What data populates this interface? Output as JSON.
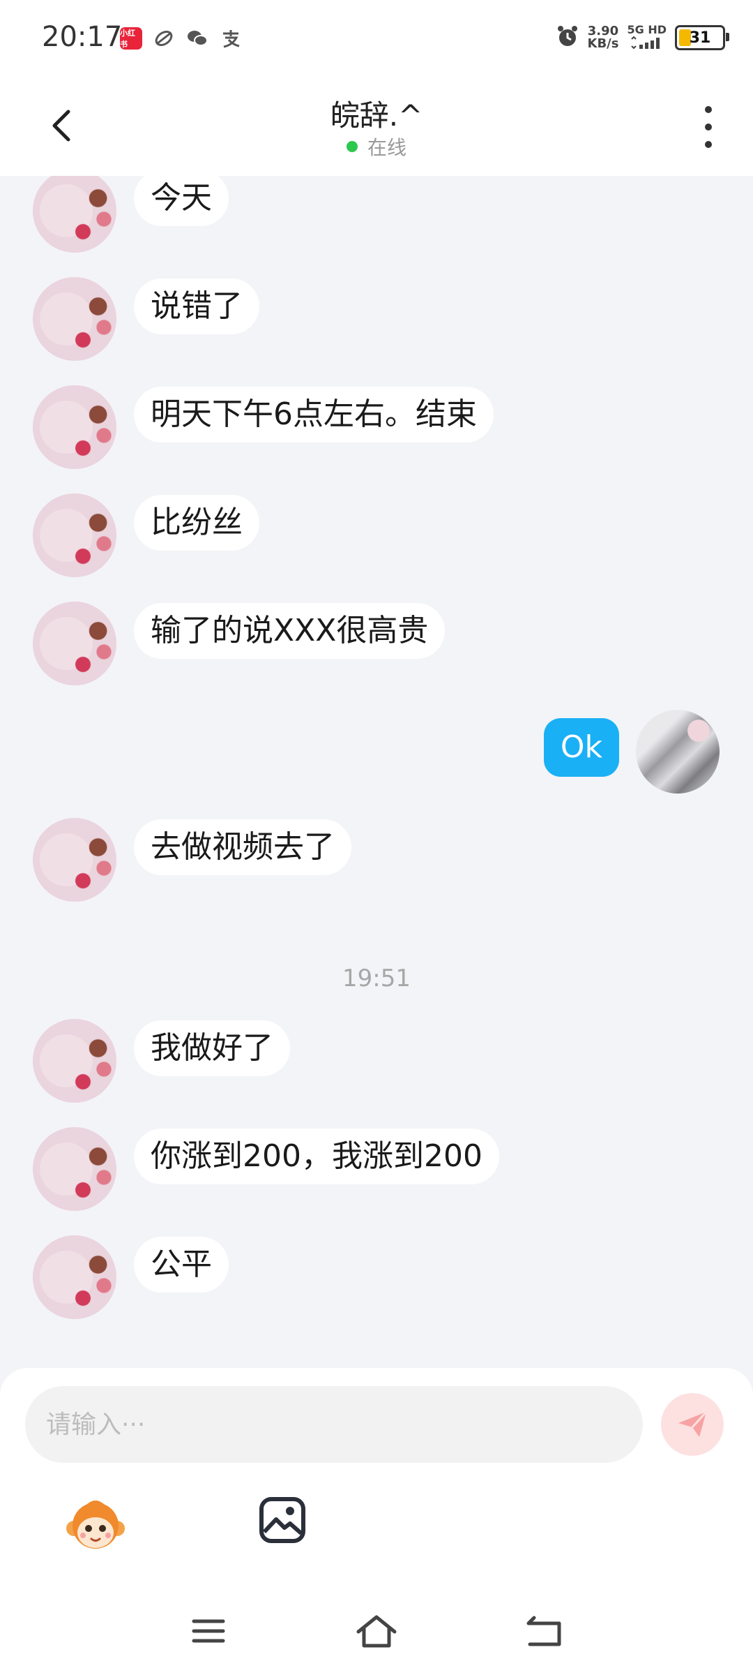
{
  "status_bar": {
    "time": "20:17",
    "app_badge": "小红书",
    "net_speed_value": "3.90",
    "net_speed_unit": "KB/s",
    "network_type": "5G HD",
    "battery": "31",
    "battery_fill_percent": 31
  },
  "header": {
    "title": "皖辞.^",
    "status": "在线",
    "status_color": "#2cc84d"
  },
  "messages": [
    {
      "side": "left",
      "text": "今天"
    },
    {
      "side": "left",
      "text": "说错了"
    },
    {
      "side": "left",
      "text": "明天下午6点左右。结束"
    },
    {
      "side": "left",
      "text": "比纷丝"
    },
    {
      "side": "left",
      "text": "输了的说XXX很高贵"
    },
    {
      "side": "right",
      "text": "Ok"
    },
    {
      "side": "left",
      "text": "去做视频去了"
    },
    {
      "type": "time",
      "text": "19:51"
    },
    {
      "side": "left",
      "text": "我做好了"
    },
    {
      "side": "left",
      "text": "你涨到200，我涨到200"
    },
    {
      "side": "left",
      "text": "公平"
    }
  ],
  "input": {
    "placeholder": "请输入···"
  },
  "colors": {
    "sent_bubble": "#1ab0f5",
    "send_button_bg": "#fde1e1",
    "send_button_icon": "#f7a3a3"
  },
  "icons": {
    "back": "chevron-left-icon",
    "more": "more-vertical-icon",
    "send": "paper-plane-icon",
    "emoji": "monkey-emoji-icon",
    "image": "image-icon",
    "nav_menu": "menu-icon",
    "nav_home": "home-icon",
    "nav_back": "back-icon"
  }
}
